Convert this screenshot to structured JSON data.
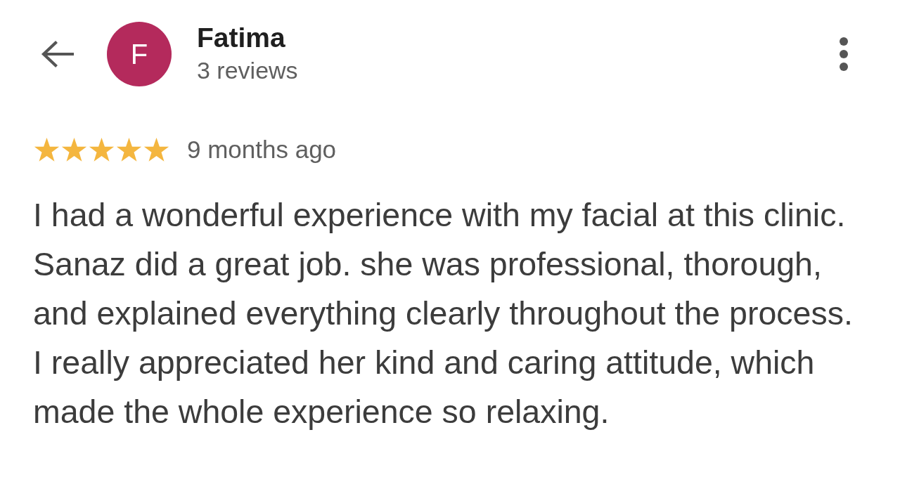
{
  "header": {
    "avatar": {
      "letter": "F"
    },
    "name": "Fatima",
    "reviews_count": "3 reviews"
  },
  "review": {
    "stars": 5,
    "time": "9 months ago",
    "text": "I had a wonderful experience with my facial at this clinic. Sanaz did a great job. she was professional, thorough, and explained everything clearly throughout the process. I really appreciated her kind and caring attitude, which made the whole experience so relaxing."
  }
}
